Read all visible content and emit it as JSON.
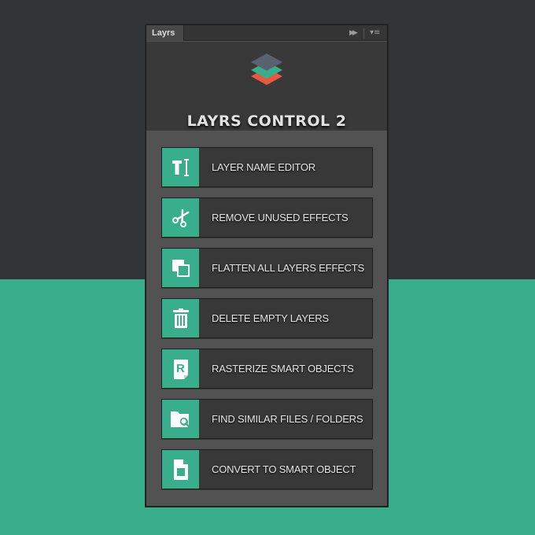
{
  "panel": {
    "tab_label": "Layrs",
    "collapse_icon": "double-chevron-right-icon",
    "menu_icon": "panel-menu-icon"
  },
  "header": {
    "logo_icon": "stacked-layers-icon",
    "title": "LAYRS CONTROL 2"
  },
  "colors": {
    "accent": "#38ae8c",
    "logo_top": "#5a6170",
    "logo_mid": "#38ae8c",
    "logo_bottom": "#e55a3c"
  },
  "buttons": [
    {
      "label": "LAYER NAME EDITOR",
      "icon": "text-cursor-icon"
    },
    {
      "label": "REMOVE UNUSED EFFECTS",
      "icon": "scissors-icon"
    },
    {
      "label": "FLATTEN ALL LAYERS EFFECTS",
      "icon": "flatten-squares-icon"
    },
    {
      "label": "DELETE EMPTY LAYERS",
      "icon": "trash-icon"
    },
    {
      "label": "RASTERIZE SMART OBJECTS",
      "icon": "rasterize-document-icon"
    },
    {
      "label": "FIND SIMILAR FILES  / FOLDERS",
      "icon": "folder-search-icon"
    },
    {
      "label": "CONVERT TO SMART OBJECT",
      "icon": "smart-object-document-icon"
    }
  ]
}
